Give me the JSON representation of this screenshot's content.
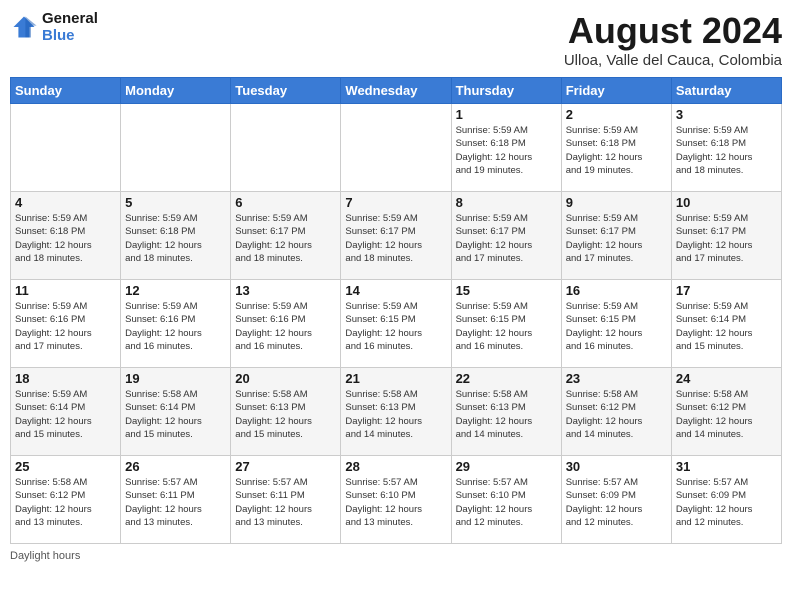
{
  "header": {
    "logo_line1": "General",
    "logo_line2": "Blue",
    "month_title": "August 2024",
    "location": "Ulloa, Valle del Cauca, Colombia"
  },
  "days_of_week": [
    "Sunday",
    "Monday",
    "Tuesday",
    "Wednesday",
    "Thursday",
    "Friday",
    "Saturday"
  ],
  "weeks": [
    [
      {
        "day": "",
        "info": ""
      },
      {
        "day": "",
        "info": ""
      },
      {
        "day": "",
        "info": ""
      },
      {
        "day": "",
        "info": ""
      },
      {
        "day": "1",
        "info": "Sunrise: 5:59 AM\nSunset: 6:18 PM\nDaylight: 12 hours\nand 19 minutes."
      },
      {
        "day": "2",
        "info": "Sunrise: 5:59 AM\nSunset: 6:18 PM\nDaylight: 12 hours\nand 19 minutes."
      },
      {
        "day": "3",
        "info": "Sunrise: 5:59 AM\nSunset: 6:18 PM\nDaylight: 12 hours\nand 18 minutes."
      }
    ],
    [
      {
        "day": "4",
        "info": "Sunrise: 5:59 AM\nSunset: 6:18 PM\nDaylight: 12 hours\nand 18 minutes."
      },
      {
        "day": "5",
        "info": "Sunrise: 5:59 AM\nSunset: 6:18 PM\nDaylight: 12 hours\nand 18 minutes."
      },
      {
        "day": "6",
        "info": "Sunrise: 5:59 AM\nSunset: 6:17 PM\nDaylight: 12 hours\nand 18 minutes."
      },
      {
        "day": "7",
        "info": "Sunrise: 5:59 AM\nSunset: 6:17 PM\nDaylight: 12 hours\nand 18 minutes."
      },
      {
        "day": "8",
        "info": "Sunrise: 5:59 AM\nSunset: 6:17 PM\nDaylight: 12 hours\nand 17 minutes."
      },
      {
        "day": "9",
        "info": "Sunrise: 5:59 AM\nSunset: 6:17 PM\nDaylight: 12 hours\nand 17 minutes."
      },
      {
        "day": "10",
        "info": "Sunrise: 5:59 AM\nSunset: 6:17 PM\nDaylight: 12 hours\nand 17 minutes."
      }
    ],
    [
      {
        "day": "11",
        "info": "Sunrise: 5:59 AM\nSunset: 6:16 PM\nDaylight: 12 hours\nand 17 minutes."
      },
      {
        "day": "12",
        "info": "Sunrise: 5:59 AM\nSunset: 6:16 PM\nDaylight: 12 hours\nand 16 minutes."
      },
      {
        "day": "13",
        "info": "Sunrise: 5:59 AM\nSunset: 6:16 PM\nDaylight: 12 hours\nand 16 minutes."
      },
      {
        "day": "14",
        "info": "Sunrise: 5:59 AM\nSunset: 6:15 PM\nDaylight: 12 hours\nand 16 minutes."
      },
      {
        "day": "15",
        "info": "Sunrise: 5:59 AM\nSunset: 6:15 PM\nDaylight: 12 hours\nand 16 minutes."
      },
      {
        "day": "16",
        "info": "Sunrise: 5:59 AM\nSunset: 6:15 PM\nDaylight: 12 hours\nand 16 minutes."
      },
      {
        "day": "17",
        "info": "Sunrise: 5:59 AM\nSunset: 6:14 PM\nDaylight: 12 hours\nand 15 minutes."
      }
    ],
    [
      {
        "day": "18",
        "info": "Sunrise: 5:59 AM\nSunset: 6:14 PM\nDaylight: 12 hours\nand 15 minutes."
      },
      {
        "day": "19",
        "info": "Sunrise: 5:58 AM\nSunset: 6:14 PM\nDaylight: 12 hours\nand 15 minutes."
      },
      {
        "day": "20",
        "info": "Sunrise: 5:58 AM\nSunset: 6:13 PM\nDaylight: 12 hours\nand 15 minutes."
      },
      {
        "day": "21",
        "info": "Sunrise: 5:58 AM\nSunset: 6:13 PM\nDaylight: 12 hours\nand 14 minutes."
      },
      {
        "day": "22",
        "info": "Sunrise: 5:58 AM\nSunset: 6:13 PM\nDaylight: 12 hours\nand 14 minutes."
      },
      {
        "day": "23",
        "info": "Sunrise: 5:58 AM\nSunset: 6:12 PM\nDaylight: 12 hours\nand 14 minutes."
      },
      {
        "day": "24",
        "info": "Sunrise: 5:58 AM\nSunset: 6:12 PM\nDaylight: 12 hours\nand 14 minutes."
      }
    ],
    [
      {
        "day": "25",
        "info": "Sunrise: 5:58 AM\nSunset: 6:12 PM\nDaylight: 12 hours\nand 13 minutes."
      },
      {
        "day": "26",
        "info": "Sunrise: 5:57 AM\nSunset: 6:11 PM\nDaylight: 12 hours\nand 13 minutes."
      },
      {
        "day": "27",
        "info": "Sunrise: 5:57 AM\nSunset: 6:11 PM\nDaylight: 12 hours\nand 13 minutes."
      },
      {
        "day": "28",
        "info": "Sunrise: 5:57 AM\nSunset: 6:10 PM\nDaylight: 12 hours\nand 13 minutes."
      },
      {
        "day": "29",
        "info": "Sunrise: 5:57 AM\nSunset: 6:10 PM\nDaylight: 12 hours\nand 12 minutes."
      },
      {
        "day": "30",
        "info": "Sunrise: 5:57 AM\nSunset: 6:09 PM\nDaylight: 12 hours\nand 12 minutes."
      },
      {
        "day": "31",
        "info": "Sunrise: 5:57 AM\nSunset: 6:09 PM\nDaylight: 12 hours\nand 12 minutes."
      }
    ]
  ],
  "footer": {
    "note": "Daylight hours"
  }
}
